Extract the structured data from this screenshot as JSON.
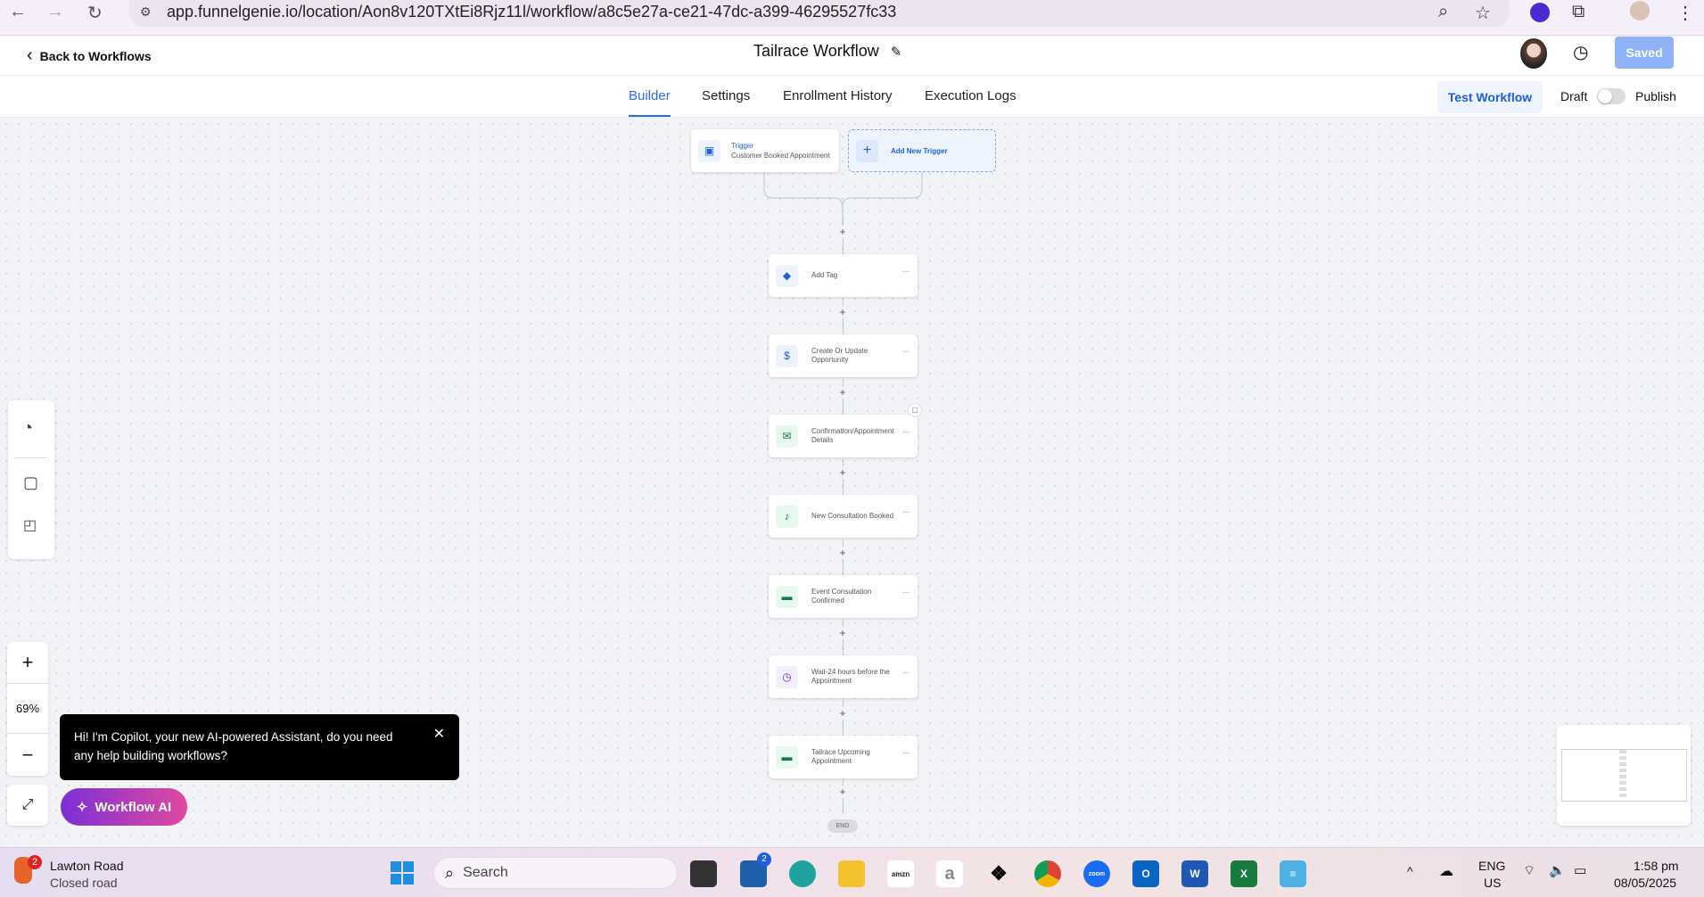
{
  "browser": {
    "url": "app.funnelgenie.io/location/Aon8v120TXtEi8Rjz11l/workflow/a8c5e27a-ce21-47dc-a399-46295527fc33"
  },
  "header": {
    "back_label": "Back to Workflows",
    "title": "Tailrace Workflow",
    "saved_label": "Saved"
  },
  "tabs": [
    {
      "label": "Builder",
      "active": true
    },
    {
      "label": "Settings"
    },
    {
      "label": "Enrollment History"
    },
    {
      "label": "Execution Logs"
    }
  ],
  "actions_bar": {
    "test_label": "Test Workflow",
    "draft_label": "Draft",
    "publish_label": "Publish",
    "published": false
  },
  "trigger": {
    "title": "Trigger",
    "subtitle": "Customer Booked Appointment",
    "add_label": "Add New Trigger"
  },
  "steps": [
    {
      "label": "Add Tag",
      "icon": "tag-icon",
      "color": "#1d5fe0"
    },
    {
      "label": "Create Or Update Opportunity",
      "icon": "dollar-icon",
      "color": "#1d5fe0"
    },
    {
      "label": "Confirmation/Appointment Details",
      "icon": "email-icon",
      "color": "#0f7a4c"
    },
    {
      "label": "New Consultation Booked",
      "icon": "bell-icon",
      "color": "#0f7a4c"
    },
    {
      "label": "Event Consultation Confirmed",
      "icon": "sms-icon",
      "color": "#0f7a4c"
    },
    {
      "label": "Wait-24 hours before the Appointment",
      "icon": "clock-icon",
      "color": "#6b2bd9"
    },
    {
      "label": "Tailrace Upcoming Appointment",
      "icon": "sms-icon",
      "color": "#0f7a4c"
    }
  ],
  "end_label": "END",
  "zoom": {
    "level": "69%"
  },
  "copilot": {
    "message": "Hi! I'm Copilot, your new AI-powered Assistant, do you need any help building workflows?",
    "button_label": "Workflow AI"
  },
  "taskbar": {
    "weather_title": "Lawton Road",
    "weather_sub": "Closed road",
    "weather_badge": "2",
    "search_placeholder": "Search",
    "store_badge": "2",
    "lang1": "ENG",
    "lang2": "US",
    "time": "1:58 pm",
    "date": "08/05/2025"
  }
}
